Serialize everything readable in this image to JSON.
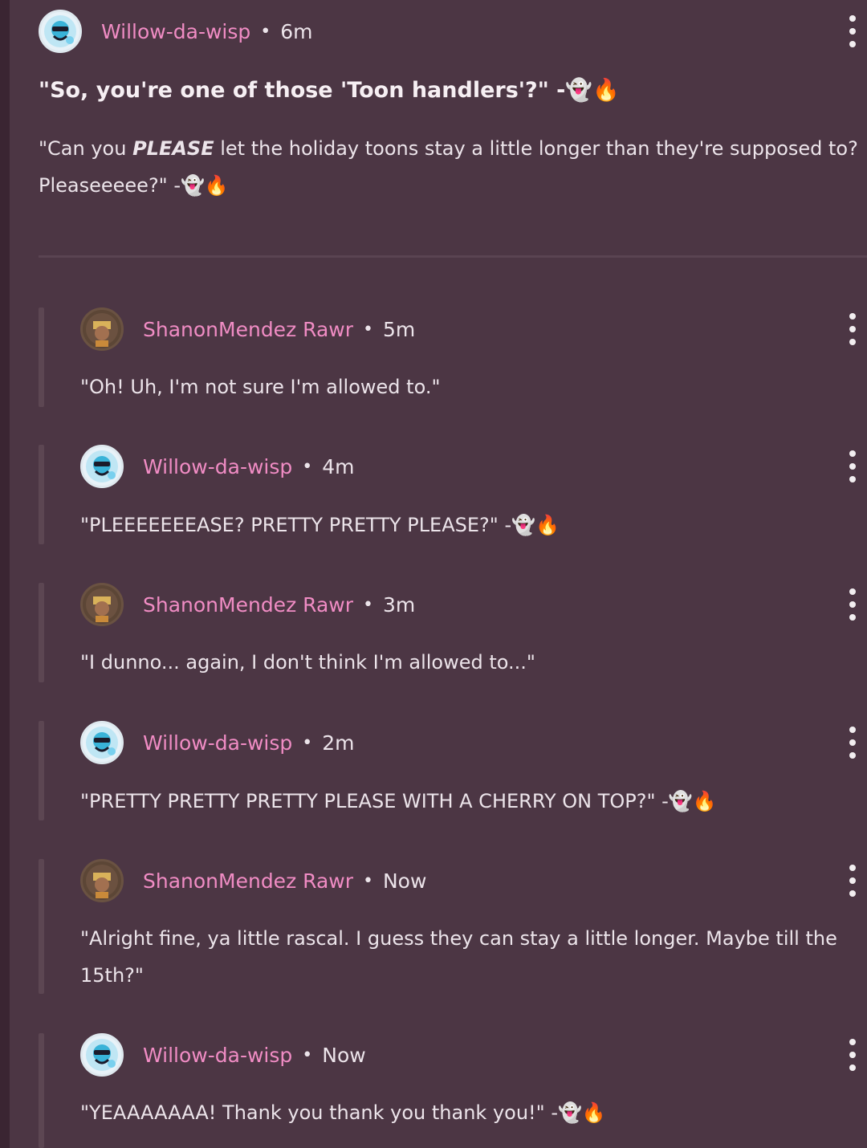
{
  "post": {
    "author": "Willow-da-wisp",
    "separator": "•",
    "time": "6m",
    "title": "\"So, you're one of those 'Toon handlers'?\" -👻🔥",
    "body_prefix": "\"Can you ",
    "body_emphasis": "PLEASE",
    "body_suffix": " let the holiday toons stay a little longer than they're supposed to? Pleaseeeee?\" -👻🔥"
  },
  "replies": [
    {
      "author": "ShanonMendez Rawr",
      "time": "5m",
      "text": "\"Oh! Uh, I'm not sure I'm allowed to.\""
    },
    {
      "author": "Willow-da-wisp",
      "time": "4m",
      "text": "\"PLEEEEEEEASE? PRETTY PRETTY PLEASE?\" -👻🔥"
    },
    {
      "author": "ShanonMendez Rawr",
      "time": "3m",
      "text": "\"I dunno... again, I don't think I'm allowed to...\""
    },
    {
      "author": "Willow-da-wisp",
      "time": "2m",
      "text": "\"PRETTY PRETTY PRETTY PLEASE WITH A CHERRY ON TOP?\" -👻🔥"
    },
    {
      "author": "ShanonMendez Rawr",
      "time": "Now",
      "text": "\"Alright fine, ya little rascal. I guess they can stay a little longer. Maybe till the 15th?\""
    },
    {
      "author": "Willow-da-wisp",
      "time": "Now",
      "text": "\"YEAAAAAAA! Thank you thank you thank you!\" -👻🔥"
    }
  ],
  "colors": {
    "background": "#4c3644",
    "username": "#f08cc4",
    "text": "#ece4ea"
  }
}
